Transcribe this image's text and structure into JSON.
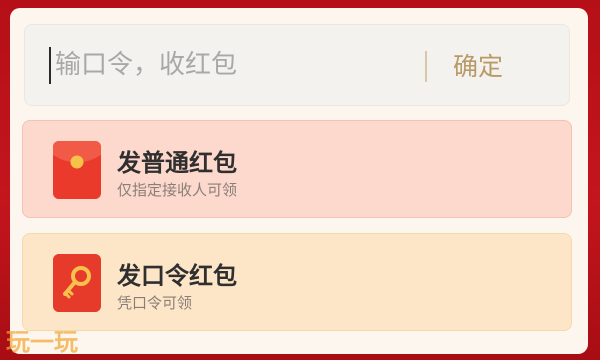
{
  "command_input": {
    "placeholder": "输口令，收红包"
  },
  "confirm_label": "确定",
  "options": [
    {
      "title": "发普通红包",
      "subtitle": "仅指定接收人可领",
      "icon": "red-envelope-icon"
    },
    {
      "title": "发口令红包",
      "subtitle": "凭口令可领",
      "icon": "key-icon"
    }
  ],
  "watermark": "玩一玩",
  "colors": {
    "frame": "#c4151d",
    "panel": "#fdf6ee",
    "normal_option": "#fdd8cc",
    "command_option": "#fde6c7",
    "icon_red": "#e9392b",
    "accent_gold": "#b89a66"
  }
}
